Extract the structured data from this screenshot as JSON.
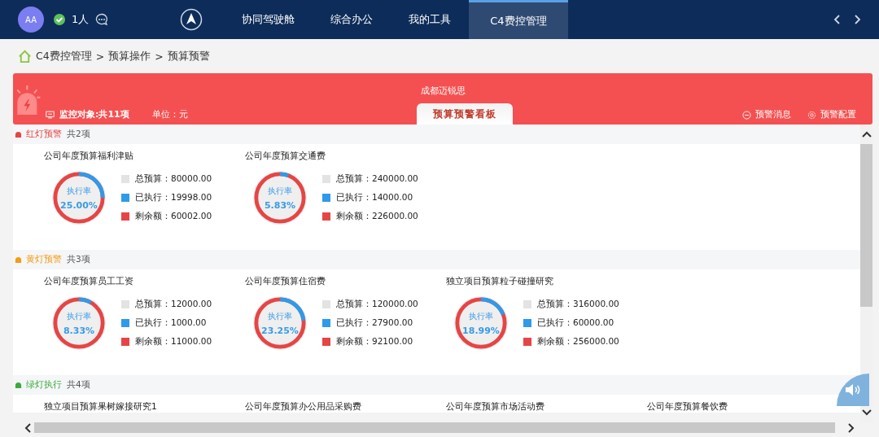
{
  "topbar": {
    "avatar": "AA",
    "online_count": "1人",
    "nav": [
      {
        "label": "协同驾驶舱",
        "selected": false
      },
      {
        "label": "综合办公",
        "selected": false
      },
      {
        "label": "我的工具",
        "selected": false
      },
      {
        "label": "C4费控管理",
        "selected": true
      }
    ]
  },
  "breadcrumb": [
    "C4费控管理",
    ">",
    "预算操作",
    ">",
    "预算预警"
  ],
  "banner": {
    "company": "成都迈锐思",
    "monitor": "监控对象:共11项",
    "unit": "单位：元",
    "tab": "预算预警看板",
    "actions": [
      {
        "kind": "message",
        "label": "预警消息"
      },
      {
        "kind": "config",
        "label": "预警配置"
      }
    ]
  },
  "sections": [
    {
      "kind": "red",
      "title": "红灯预警",
      "count": "共2项",
      "items": [
        {
          "title": "公司年度预算福利津贴",
          "rate_label": "执行率",
          "rate": "25.00%",
          "level": 0.25,
          "stats": [
            {
              "kind": "total",
              "text": "总预算：80000.00"
            },
            {
              "kind": "done",
              "text": "已执行：19998.00"
            },
            {
              "kind": "left",
              "text": "剩余额：60002.00"
            }
          ]
        },
        {
          "title": "公司年度预算交通费",
          "rate_label": "执行率",
          "rate": "5.83%",
          "level": 0.0583,
          "stats": [
            {
              "kind": "total",
              "text": "总预算：240000.00"
            },
            {
              "kind": "done",
              "text": "已执行：14000.00"
            },
            {
              "kind": "left",
              "text": "剩余额：226000.00"
            }
          ]
        }
      ]
    },
    {
      "kind": "yellow",
      "title": "黄灯预警",
      "count": "共3项",
      "items": [
        {
          "title": "公司年度预算员工工资",
          "rate_label": "执行率",
          "rate": "8.33%",
          "level": 0.0833,
          "stats": [
            {
              "kind": "total",
              "text": "总预算：12000.00"
            },
            {
              "kind": "done",
              "text": "已执行：1000.00"
            },
            {
              "kind": "left",
              "text": "剩余额：11000.00"
            }
          ]
        },
        {
          "title": "公司年度预算住宿费",
          "rate_label": "执行率",
          "rate": "23.25%",
          "level": 0.2325,
          "stats": [
            {
              "kind": "total",
              "text": "总预算：120000.00"
            },
            {
              "kind": "done",
              "text": "已执行：27900.00"
            },
            {
              "kind": "left",
              "text": "剩余额：92100.00"
            }
          ]
        },
        {
          "title": "独立项目预算粒子碰撞研究",
          "rate_label": "执行率",
          "rate": "18.99%",
          "level": 0.1899,
          "stats": [
            {
              "kind": "total",
              "text": "总预算：316000.00"
            },
            {
              "kind": "done",
              "text": "已执行：60000.00"
            },
            {
              "kind": "left",
              "text": "剩余额：256000.00"
            }
          ]
        }
      ]
    },
    {
      "kind": "green",
      "title": "绿灯执行",
      "count": "共4项",
      "items": [
        {
          "title": "独立项目预算果树嫁接研究1"
        },
        {
          "title": "公司年度预算办公用品采购费"
        },
        {
          "title": "公司年度预算市场活动费"
        },
        {
          "title": "公司年度预算餐饮费"
        }
      ]
    }
  ]
}
